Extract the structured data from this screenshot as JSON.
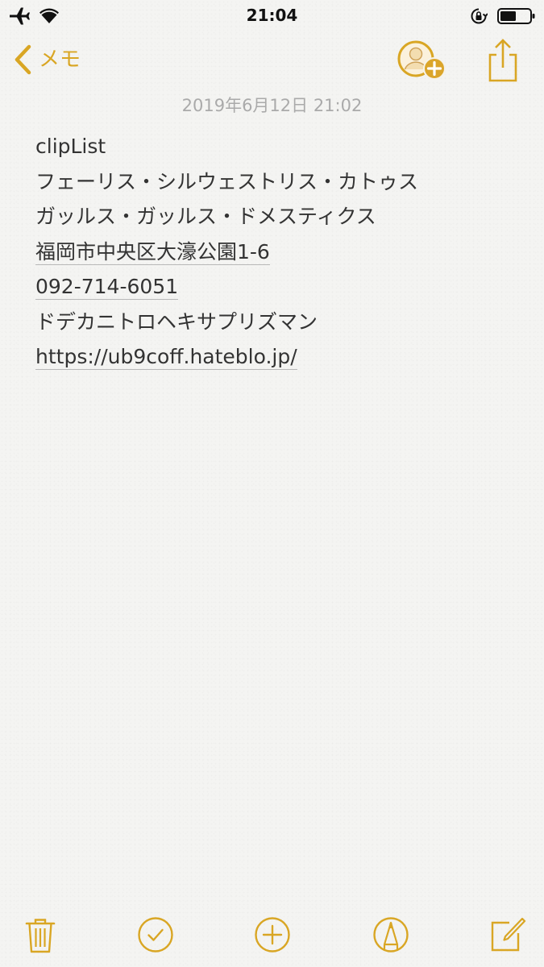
{
  "status_bar": {
    "time": "21:04",
    "left_icons": [
      "airplane-icon",
      "wifi-icon"
    ],
    "right_icons": [
      "orientation-lock-icon",
      "battery-icon"
    ],
    "battery_level": 0.55
  },
  "nav": {
    "back_label": "メモ"
  },
  "note": {
    "date": "2019年6月12日 21:02",
    "lines": [
      "clipList",
      "フェーリス・シルウェストリス・カトゥス",
      "ガッルス・ガッルス・ドメスティクス",
      "福岡市中央区大濠公園1-6",
      "092-714-6051",
      "ドデカニトロヘキサプリズマン",
      "https://ub9coff.hateblo.jp/"
    ]
  },
  "toolbar": {
    "icons": [
      "trash-icon",
      "checklist-icon",
      "add-icon",
      "markup-icon",
      "compose-icon"
    ]
  },
  "colors": {
    "accent": "#d9a624",
    "text": "#333333",
    "date_text": "#aaaaaa",
    "background": "#f4f4f2"
  }
}
